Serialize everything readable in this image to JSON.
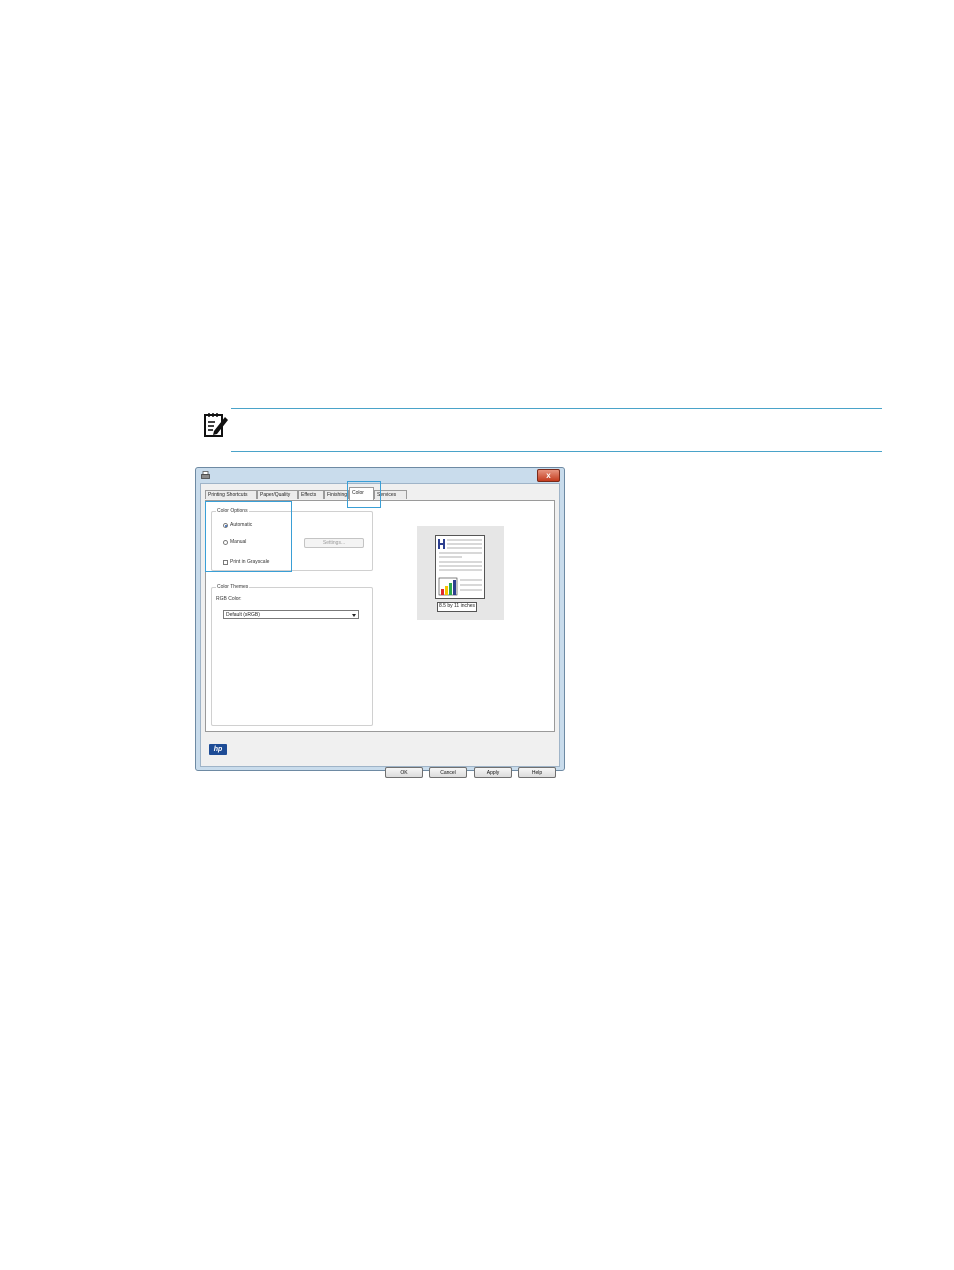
{
  "note": {
    "icon": "note-pencil-icon"
  },
  "dialog": {
    "title_icon": "printer-icon",
    "close_label": "x",
    "tabs": [
      {
        "label": "Printing Shortcuts"
      },
      {
        "label": "Paper/Quality"
      },
      {
        "label": "Effects"
      },
      {
        "label": "Finishing"
      },
      {
        "label": "Color"
      },
      {
        "label": "Services"
      }
    ],
    "active_tab": "Color",
    "color_options": {
      "label": "Color Options",
      "automatic_label": "Automatic",
      "manual_label": "Manual",
      "grayscale_label": "Print in Grayscale",
      "settings_label": "Settings...",
      "selected": "Automatic",
      "grayscale_checked": false
    },
    "color_themes": {
      "label": "Color Themes",
      "rgb_label": "RGB Color:",
      "rgb_value": "Default (sRGB)"
    },
    "preview": {
      "paper_size": "8.5 by 11 inches"
    },
    "logo": "hp",
    "buttons": {
      "ok": "OK",
      "cancel": "Cancel",
      "apply": "Apply",
      "help": "Help"
    }
  },
  "colors": {
    "highlight": "#3a9fd6",
    "rule": "#4aa3c9"
  }
}
